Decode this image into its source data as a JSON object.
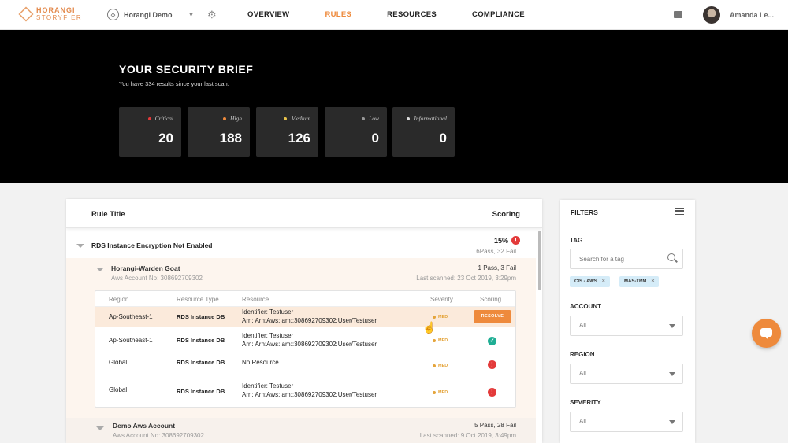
{
  "brand": {
    "line1": "HORANGI",
    "line2": "STORYFIER"
  },
  "org": {
    "name": "Horangi Demo"
  },
  "nav": [
    {
      "label": "OVERVIEW",
      "active": false
    },
    {
      "label": "RULES",
      "active": true
    },
    {
      "label": "RESOURCES",
      "active": false
    },
    {
      "label": "COMPLIANCE",
      "active": false
    }
  ],
  "user": {
    "name": "Amanda Le..."
  },
  "brief": {
    "title": "YOUR SECURITY BRIEF",
    "subtitle": "You have 334 results since your last scan.",
    "cards": [
      {
        "label": "Critical",
        "count": "20",
        "color": "#e33a3a"
      },
      {
        "label": "High",
        "count": "188",
        "color": "#ee8a3c"
      },
      {
        "label": "Medium",
        "count": "126",
        "color": "#e9c34a"
      },
      {
        "label": "Low",
        "count": "0",
        "color": "#999999"
      },
      {
        "label": "Informational",
        "count": "0",
        "color": "#dddddd"
      }
    ]
  },
  "rules": {
    "header": {
      "title": "Rule Title",
      "scoring": "Scoring"
    },
    "rule": {
      "name": "RDS Instance Encryption Not Enabled",
      "percent": "15%",
      "pass_fail": "6Pass, 32 Fail"
    },
    "accounts": [
      {
        "name": "Horangi-Warden Goat",
        "account_no": "Aws Account No: 308692709302",
        "pass_fail": "1 Pass, 3 Fail",
        "last_scanned": "Last scanned: 23 Oct 2019, 3:29pm"
      },
      {
        "name": "Demo Aws Account",
        "account_no": "Aws Account No: 308692709302",
        "pass_fail": "5 Pass, 28 Fail",
        "last_scanned": "Last scanned: 9 Oct 2019, 3:49pm"
      }
    ],
    "table": {
      "columns": [
        "Region",
        "Resource Type",
        "Resource",
        "Severity",
        "Scoring"
      ],
      "rows": [
        {
          "region": "Ap-Southeast-1",
          "type": "RDS Instance DB",
          "res1": "Identifier: Testuser",
          "res2": "Arn: Arn:Aws:Iam::308692709302:User/Testuser",
          "severity": "MED",
          "scoring": "RESOLVE"
        },
        {
          "region": "Ap-Southeast-1",
          "type": "RDS Instance DB",
          "res1": "Identifier: Testuser",
          "res2": "Arn: Arn:Aws:Iam::308692709302:User/Testuser",
          "severity": "MED",
          "scoring": "pass"
        },
        {
          "region": "Global",
          "type": "RDS Instance DB",
          "res1": "No Resource",
          "res2": "",
          "severity": "MED",
          "scoring": "fail"
        },
        {
          "region": "Global",
          "type": "RDS Instance DB",
          "res1": "Identifier: Testuser",
          "res2": "Arn: Arn:Aws:Iam::308692709302:User/Testuser",
          "severity": "MED",
          "scoring": "fail"
        }
      ]
    }
  },
  "filters": {
    "title": "FILTERS",
    "tag_label": "TAG",
    "tag_placeholder": "Search for a tag",
    "tags": [
      "CIS - AWS",
      "MAS-TRM"
    ],
    "account_label": "ACCOUNT",
    "account_value": "All",
    "region_label": "REGION",
    "region_value": "All",
    "severity_label": "SEVERITY",
    "severity_value": "All"
  }
}
